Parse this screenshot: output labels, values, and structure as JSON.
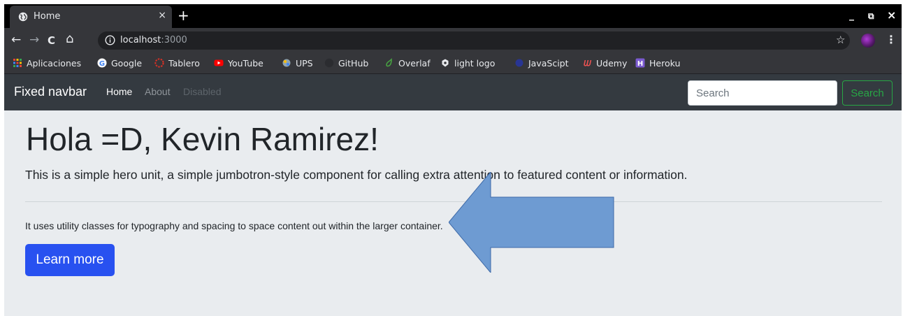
{
  "browser": {
    "tab": {
      "title": "Home",
      "close": "×"
    },
    "new_tab": "+",
    "window_controls": {
      "minimize": "_",
      "restore": "⧉",
      "close": "×"
    },
    "nav": {
      "back": "←",
      "forward": "→",
      "reload": "C",
      "home": "⌂"
    },
    "address": {
      "host": "localhost",
      "port": ":3000"
    },
    "star": "☆",
    "menu": "⋮",
    "bookmarks": [
      {
        "label": "Aplicaciones",
        "icon": "apps-grid-icon",
        "color": "#e94235"
      },
      {
        "label": "Google",
        "icon": "google-icon",
        "color": "#ffffff"
      },
      {
        "label": "Tablero",
        "icon": "tablero-icon",
        "color": "#d93025"
      },
      {
        "label": "YouTube",
        "icon": "youtube-icon",
        "color": "#ff0000"
      },
      {
        "label": "UPS",
        "icon": "ups-icon",
        "color": "#b0bec5"
      },
      {
        "label": "GitHub",
        "icon": "github-icon",
        "color": "#3a3b3f"
      },
      {
        "label": "Overlaf",
        "icon": "overleaf-icon",
        "color": "#47a141"
      },
      {
        "label": "light logo",
        "icon": "light-logo-icon",
        "color": "#e8eaed"
      },
      {
        "label": "JavaScipt",
        "icon": "javascript-icon",
        "color": "#283593"
      },
      {
        "label": "Udemy",
        "icon": "udemy-icon",
        "color": "#ec5252"
      },
      {
        "label": "Heroku",
        "icon": "heroku-icon",
        "color": "#7b5bd0"
      }
    ]
  },
  "navbar": {
    "brand": "Fixed navbar",
    "links": [
      {
        "label": "Home",
        "state": "active"
      },
      {
        "label": "About",
        "state": "muted"
      },
      {
        "label": "Disabled",
        "state": "disabled"
      }
    ],
    "search_placeholder": "Search",
    "search_button": "Search"
  },
  "hero": {
    "title": "Hola =D, Kevin Ramirez!",
    "lead": "This is a simple hero unit, a simple jumbotron-style component for calling extra attention to featured content or information.",
    "text": "It uses utility classes for typography and spacing to space content out within the larger container.",
    "button": "Learn more"
  },
  "colors": {
    "navbar_bg": "#343a40",
    "jumbotron_bg": "#e9ecef",
    "primary": "#2851f0",
    "success": "#28a745",
    "annotation_arrow": "#6e9bd2"
  }
}
